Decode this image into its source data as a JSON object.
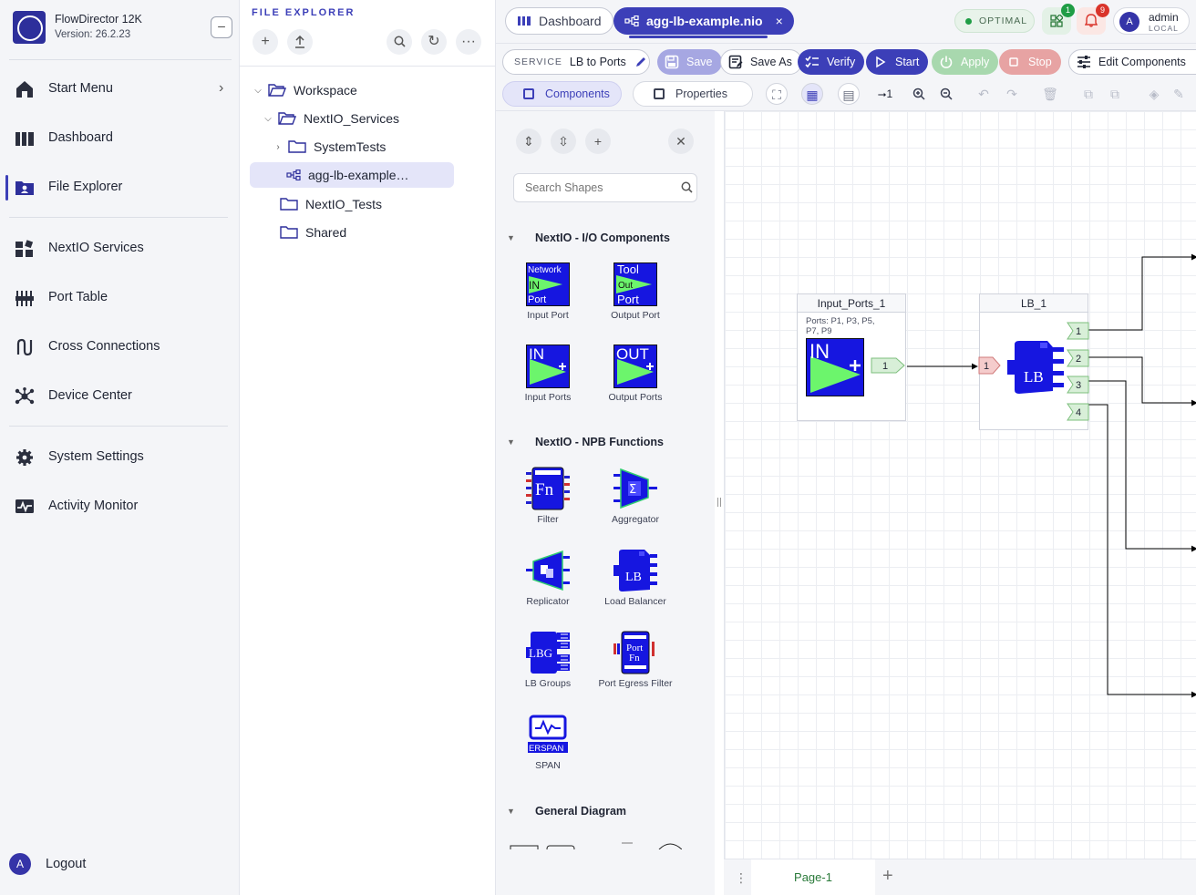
{
  "app": {
    "name": "FlowDirector 12K",
    "version": "Version: 26.2.23",
    "collapse_icon": "minus-icon"
  },
  "nav": {
    "items": [
      {
        "label": "Start Menu",
        "icon": "home-icon"
      },
      {
        "label": "Dashboard",
        "icon": "dashboard-icon"
      },
      {
        "label": "File Explorer",
        "icon": "folder-user-icon"
      },
      {
        "label": "NextIO Services",
        "icon": "services-icon"
      },
      {
        "label": "Port Table",
        "icon": "ports-icon"
      },
      {
        "label": "Cross Connections",
        "icon": "cross-connect-icon"
      },
      {
        "label": "Device Center",
        "icon": "device-icon"
      },
      {
        "label": "System Settings",
        "icon": "gear-icon"
      },
      {
        "label": "Activity Monitor",
        "icon": "activity-icon"
      }
    ],
    "logout": {
      "label": "Logout",
      "avatar": "A"
    }
  },
  "file_explorer": {
    "title": "FILE EXPLORER",
    "tree": [
      {
        "label": "Workspace"
      },
      {
        "label": "NextIO_Services"
      },
      {
        "label": "SystemTests"
      },
      {
        "label": "agg-lb-example…"
      },
      {
        "label": "NextIO_Tests"
      },
      {
        "label": "Shared"
      }
    ]
  },
  "tabs": [
    {
      "label": "Dashboard"
    },
    {
      "label": "agg-lb-example.nio",
      "close": "×"
    }
  ],
  "header": {
    "status": "OPTIMAL",
    "apps_badge": "1",
    "alerts_badge": "9",
    "user": {
      "avatar": "A",
      "name": "admin",
      "realm": "LOCAL"
    },
    "colors": {
      "accent": "#3c3fb8",
      "ok": "#1f9d45",
      "alert": "#d9342b"
    }
  },
  "toolbar": {
    "service_key": "SERVICE",
    "service_value": "LB to Ports",
    "save": "Save",
    "save_as": "Save As",
    "verify": "Verify",
    "start": "Start",
    "apply": "Apply",
    "stop": "Stop",
    "edit_components": "Edit Components",
    "components": "Components",
    "properties": "Properties",
    "next_one": "⭢1"
  },
  "palette": {
    "search_placeholder": "Search Shapes",
    "categories": [
      {
        "title": "NextIO - I/O Components",
        "shapes": [
          {
            "label": "Input Port",
            "icon_lines": [
              "Network",
              "IN",
              "Port"
            ]
          },
          {
            "label": "Output Port",
            "icon_lines": [
              "Tool",
              "Out",
              "Port"
            ]
          },
          {
            "label": "Input Ports",
            "icon_lines": [
              "IN"
            ]
          },
          {
            "label": "Output Ports",
            "icon_lines": [
              "OUT"
            ]
          }
        ]
      },
      {
        "title": "NextIO - NPB Functions",
        "shapes": [
          {
            "label": "Filter",
            "icon_lines": [
              "Fn"
            ]
          },
          {
            "label": "Aggregator",
            "icon_lines": [
              "Σ"
            ]
          },
          {
            "label": "Replicator"
          },
          {
            "label": "Load Balancer",
            "icon_lines": [
              "LB"
            ]
          },
          {
            "label": "LB Groups",
            "icon_lines": [
              "LBG"
            ]
          },
          {
            "label": "Port Egress Filter",
            "icon_lines": [
              "Port",
              "Fn"
            ]
          },
          {
            "label": "SPAN",
            "icon_lines": [
              "ERSPAN"
            ]
          }
        ]
      },
      {
        "title": "General Diagram"
      }
    ]
  },
  "canvas": {
    "nodes": [
      {
        "title": "Input_Ports_1",
        "subtitle": "Ports: P1, P3, P5, P7, P9",
        "icon_text": "IN",
        "out_port": "1"
      },
      {
        "title": "LB_1",
        "icon_text": "LB",
        "in_port": "1",
        "out_ports": [
          "1",
          "2",
          "3",
          "4"
        ]
      }
    ],
    "page_tab": "Page-1"
  }
}
